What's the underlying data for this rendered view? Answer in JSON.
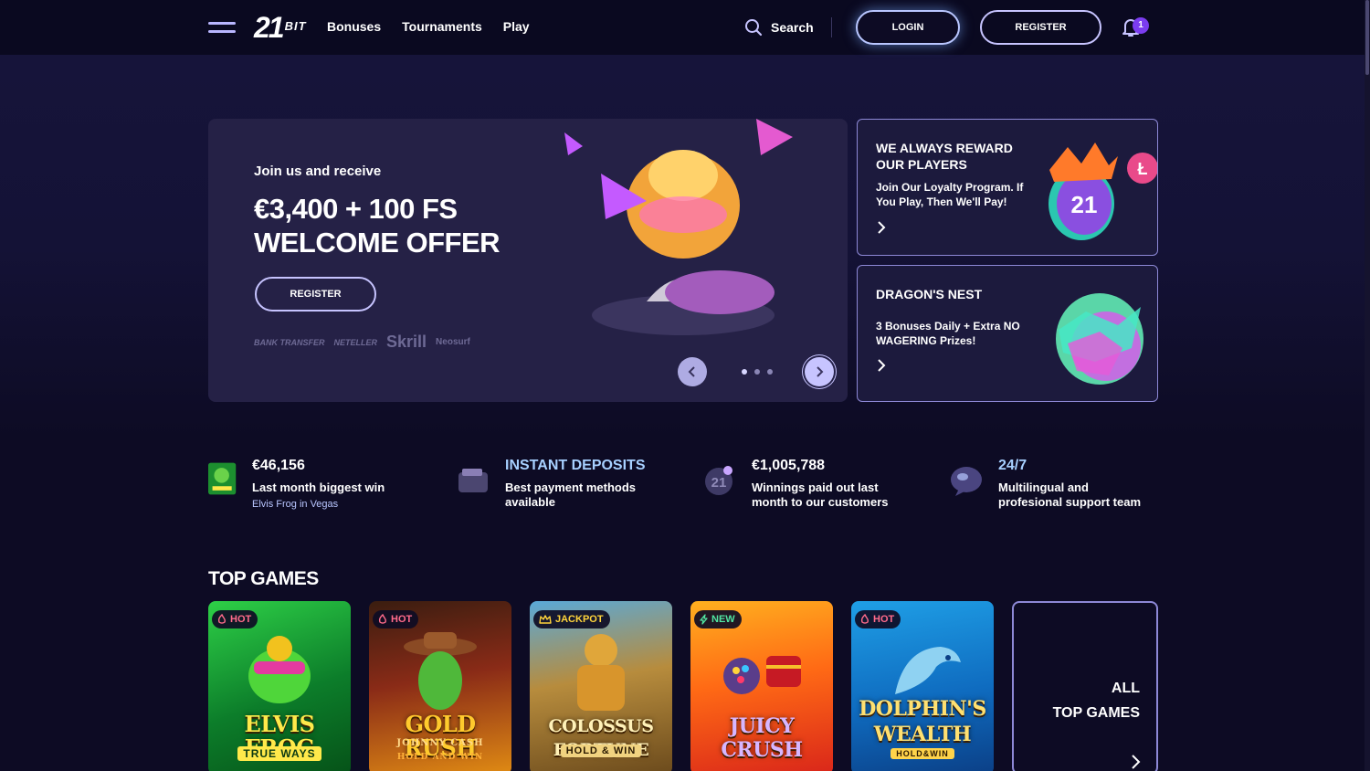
{
  "header": {
    "logo_number": "21",
    "logo_text": "BIT",
    "nav": [
      "Bonuses",
      "Tournaments",
      "Play"
    ],
    "search_label": "Search",
    "login_label": "LOGIN",
    "register_label": "REGISTER",
    "notification_count": "1"
  },
  "hero": {
    "subtitle": "Join us and receive",
    "title": "€3,400 + 100 FS WELCOME OFFER",
    "register_label": "REGISTER",
    "payment_methods": [
      "BANK TRANSFER",
      "NETELLER",
      "Skrill",
      "Neosurf"
    ],
    "slides": 3,
    "active_slide": 1
  },
  "promos": [
    {
      "title": "WE ALWAYS REWARD OUR PLAYERS",
      "text": "Join Our Loyalty Program. If You Play, Then We'll Pay!"
    },
    {
      "title": "DRAGON'S NEST",
      "text": "3 Bonuses Daily + Extra NO WAGERING Prizes!"
    }
  ],
  "stats": [
    {
      "value": "€46,156",
      "desc": "Last month biggest win",
      "link": "Elvis Frog in Vegas"
    },
    {
      "value": "INSTANT DEPOSITS",
      "desc_line1": "Best payment methods",
      "desc_line2": "available"
    },
    {
      "value": "€1,005,788",
      "desc_line1": "Winnings paid out last",
      "desc_line2": "month to our customers"
    },
    {
      "value": "24/7",
      "desc_line1": "Multilingual and",
      "desc_line2": "profesional support team"
    }
  ],
  "top_games": {
    "title": "TOP GAMES",
    "games": [
      {
        "badge": "HOT",
        "name": "ELVIS FROG",
        "tag": "TRUE WAYS"
      },
      {
        "badge": "HOT",
        "name": "GOLD RUSH",
        "tag": "JOHNNY CASH",
        "tag2": "HOLD AND WIN"
      },
      {
        "badge": "JACKPOT",
        "name": "COLOSSUS FORTUNE",
        "tag": "HOLD & WIN"
      },
      {
        "badge": "NEW",
        "name": "JUICY CRUSH"
      },
      {
        "badge": "HOT",
        "name": "DOLPHIN'S WEALTH",
        "tag": "HOLD&WIN"
      }
    ],
    "all_line1": "ALL",
    "all_line2": "TOP GAMES"
  },
  "colors": {
    "background": "#0d0b24",
    "hero_card": "#252146",
    "accent_border": "#c7c4ff",
    "badge_purple": "#7b3cf0",
    "hot": "#ff6b8b",
    "jackpot": "#ffd43b",
    "new": "#52e6a2"
  },
  "icons": [
    "menu-icon",
    "search-icon",
    "bell-icon",
    "chevron-left-icon",
    "chevron-right-icon",
    "flame-icon",
    "crown-icon",
    "bolt-icon",
    "wallet-icon",
    "coin-icon",
    "chat-bubble-icon"
  ]
}
